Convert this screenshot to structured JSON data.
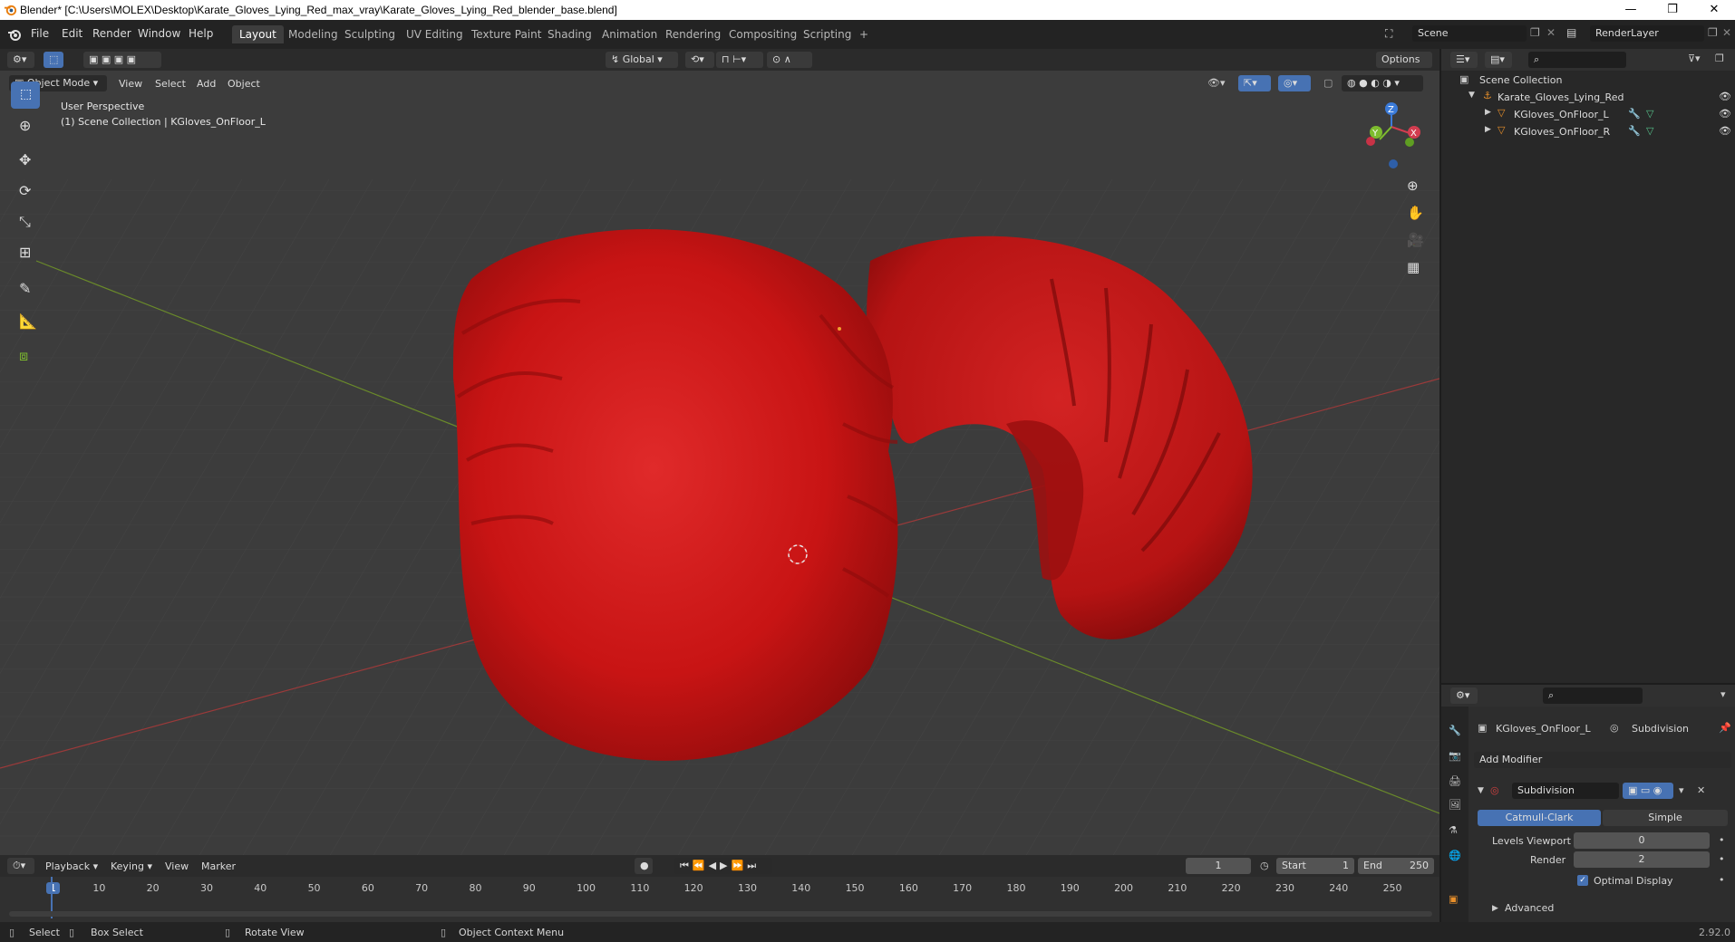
{
  "window": {
    "title": "Blender* [C:\\Users\\MOLEX\\Desktop\\Karate_Gloves_Lying_Red_max_vray\\Karate_Gloves_Lying_Red_blender_base.blend]",
    "controls": [
      "—",
      "❐",
      "✕"
    ]
  },
  "menu": [
    "File",
    "Edit",
    "Render",
    "Window",
    "Help"
  ],
  "workspaces": [
    "Layout",
    "Modeling",
    "Sculpting",
    "UV Editing",
    "Texture Paint",
    "Shading",
    "Animation",
    "Rendering",
    "Compositing",
    "Scripting",
    "+"
  ],
  "active_workspace": "Layout",
  "scene": {
    "label": "Scene",
    "render_layer": "RenderLayer"
  },
  "vp_header": {
    "transform_orientation": "Global",
    "options_label": "Options"
  },
  "vp_menu": {
    "mode": "Object Mode",
    "items": [
      "View",
      "Select",
      "Add",
      "Object"
    ]
  },
  "viewport": {
    "perspective": "User Perspective",
    "collection_info": "(1) Scene Collection | KGloves_OnFloor_L",
    "gizmo_axes": {
      "x": "X",
      "y": "Y",
      "z": "Z"
    }
  },
  "tools": [
    {
      "name": "select-box-tool",
      "icon": "cursor-icon"
    },
    {
      "name": "cursor-tool",
      "icon": "crosshair-icon"
    },
    {
      "name": "move-tool",
      "icon": "move-icon"
    },
    {
      "name": "rotate-tool",
      "icon": "rotate-icon"
    },
    {
      "name": "scale-tool",
      "icon": "scale-icon"
    },
    {
      "name": "transform-tool",
      "icon": "transform-icon"
    },
    {
      "name": "annotate-tool",
      "icon": "pencil-icon"
    },
    {
      "name": "measure-tool",
      "icon": "ruler-icon"
    },
    {
      "name": "add-cube-tool",
      "icon": "cube-icon"
    }
  ],
  "outliner": {
    "root": "Scene Collection",
    "collection": "Karate_Gloves_Lying_Red",
    "objects": [
      "KGloves_OnFloor_L",
      "KGloves_OnFloor_R"
    ]
  },
  "properties": {
    "object_name": "KGloves_OnFloor_L",
    "modifier_tab": "Subdivision",
    "add_modifier": "Add Modifier",
    "modifier_name": "Subdivision",
    "type_catmull": "Catmull-Clark",
    "type_simple": "Simple",
    "levels_viewport_label": "Levels Viewport",
    "levels_viewport_value": "0",
    "render_label": "Render",
    "render_value": "2",
    "optimal_display": "Optimal Display",
    "advanced": "Advanced"
  },
  "timeline": {
    "menus": [
      "Playback",
      "Keying",
      "View",
      "Marker"
    ],
    "current_frame": "1",
    "start_label": "Start",
    "start_value": "1",
    "end_label": "End",
    "end_value": "250",
    "ticks": [
      "1",
      "10",
      "20",
      "30",
      "40",
      "50",
      "60",
      "70",
      "80",
      "90",
      "100",
      "110",
      "120",
      "130",
      "140",
      "150",
      "160",
      "170",
      "180",
      "190",
      "200",
      "210",
      "220",
      "230",
      "240",
      "250"
    ]
  },
  "status": {
    "select": "Select",
    "box_select": "Box Select",
    "rotate_view": "Rotate View",
    "context_menu": "Object Context Menu",
    "version": "2.92.0"
  }
}
